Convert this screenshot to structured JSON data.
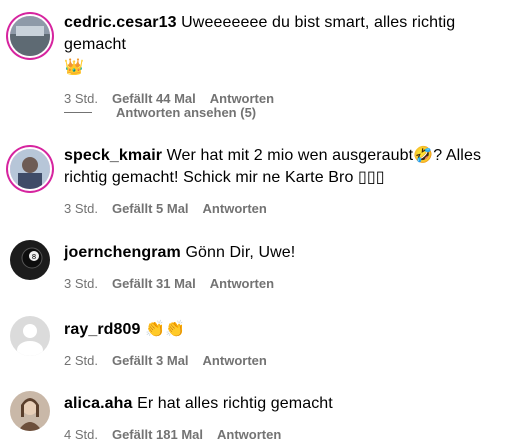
{
  "comments": [
    {
      "username": "cedric.cesar13",
      "text": "Uweeeeeee du bist smart, alles richtig gemacht",
      "emoji": "👑",
      "time": "3 Std.",
      "likes": "Gefällt 44 Mal",
      "reply": "Antworten",
      "avatar": "avatar-cedric"
    },
    {
      "username": "speck_kmair",
      "text": "Wer hat mit 2 mio wen ausgeraubt🤣? Alles richtig gemacht! Schick mir ne Karte Bro ",
      "emoji": "▯▯▯",
      "time": "3 Std.",
      "likes": "Gefällt 5 Mal",
      "reply": "Antworten",
      "avatar": "avatar-speck"
    },
    {
      "username": "joernchengram",
      "text": "Gönn Dir, Uwe!",
      "time": "3 Std.",
      "likes": "Gefällt 31 Mal",
      "reply": "Antworten",
      "avatar": "avatar-joern"
    },
    {
      "username": "ray_rd809",
      "text": "👏👏",
      "time": "2 Std.",
      "likes": "Gefällt 3 Mal",
      "reply": "Antworten",
      "avatar": "avatar-ray"
    },
    {
      "username": "alica.aha",
      "text": "Er hat alles richtig gemacht",
      "time": "4 Std.",
      "likes": "Gefällt 181 Mal",
      "reply": "Antworten",
      "avatar": "avatar-alica"
    }
  ],
  "replies_toggle": "Antworten ansehen (5)",
  "colors": {
    "muted": "#737373",
    "ring": "#d6249f"
  }
}
